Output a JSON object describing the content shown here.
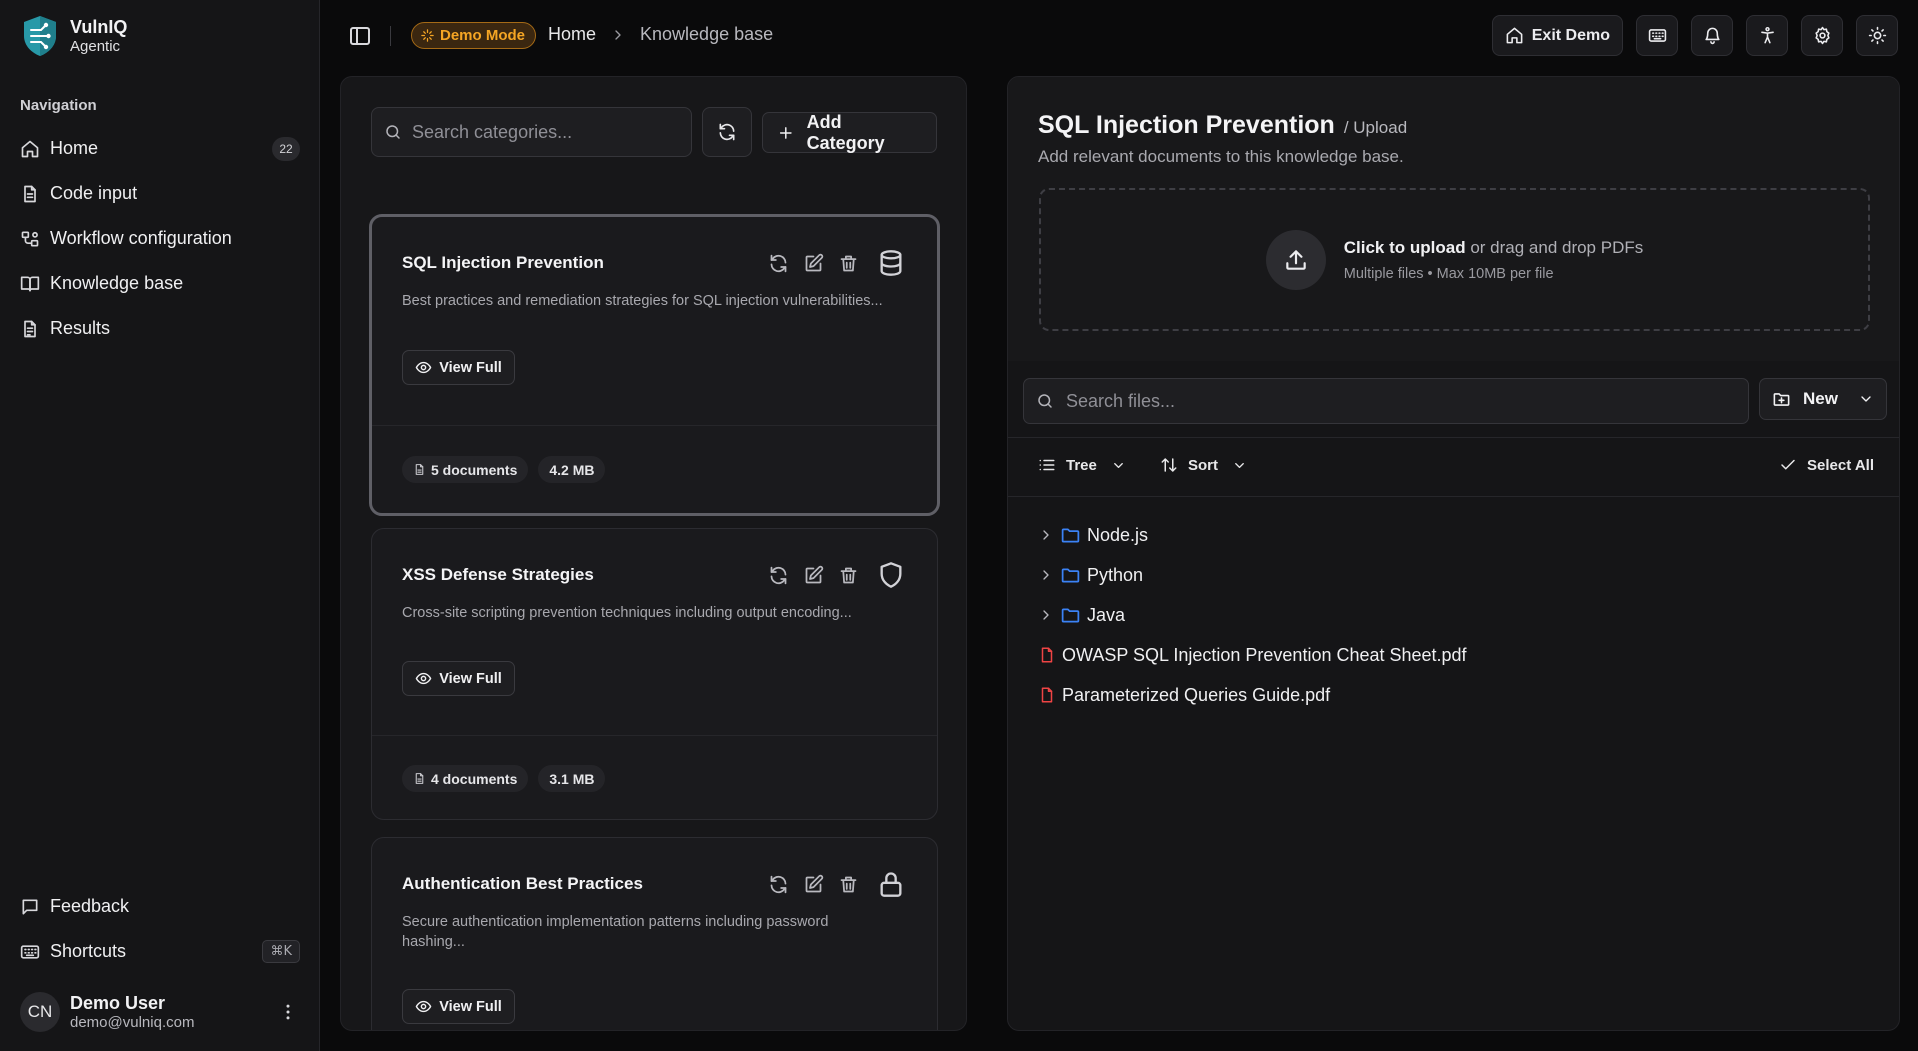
{
  "brand": {
    "name": "VulnIQ",
    "subtitle": "Agentic"
  },
  "sidebar": {
    "heading": "Navigation",
    "items": [
      {
        "label": "Home",
        "icon": "home-icon",
        "count": "22"
      },
      {
        "label": "Code input",
        "icon": "file-text-icon"
      },
      {
        "label": "Workflow configuration",
        "icon": "workflow-icon"
      },
      {
        "label": "Knowledge base",
        "icon": "book-open-icon"
      },
      {
        "label": "Results",
        "icon": "clipboard-icon"
      }
    ],
    "bottom": [
      {
        "label": "Feedback",
        "icon": "message-square-icon"
      },
      {
        "label": "Shortcuts",
        "icon": "keyboard-icon",
        "kbd": "⌘K"
      }
    ],
    "user": {
      "initials": "CN",
      "name": "Demo User",
      "email": "demo@vulniq.com"
    }
  },
  "topbar": {
    "demo_badge": "Demo Mode",
    "breadcrumbs": [
      "Home",
      "Knowledge base"
    ],
    "exit_demo": "Exit Demo"
  },
  "categories": {
    "search_placeholder": "Search categories...",
    "add_label": "Add Category",
    "view_full_label": "View Full",
    "items": [
      {
        "title": "SQL Injection Prevention",
        "description": "Best practices and remediation strategies for SQL injection vulnerabilities...",
        "documents": "5 documents",
        "size": "4.2 MB",
        "icon": "database-icon"
      },
      {
        "title": "XSS Defense Strategies",
        "description": "Cross-site scripting prevention techniques including output encoding...",
        "documents": "4 documents",
        "size": "3.1 MB",
        "icon": "shield-icon"
      },
      {
        "title": "Authentication Best Practices",
        "description": "Secure authentication implementation patterns including password hashing...",
        "icon": "lock-icon"
      }
    ]
  },
  "detail": {
    "title": "SQL Injection Prevention",
    "title_suffix": "/ Upload",
    "subtitle": "Add relevant documents to this knowledge base.",
    "upload_strong": "Click to upload",
    "upload_rest": " or drag and drop PDFs",
    "upload_hint": "Multiple files • Max 10MB per file",
    "file_search_placeholder": "Search files...",
    "new_label": "New",
    "view_mode": "Tree",
    "sort_label": "Sort",
    "select_all": "Select All",
    "tree": [
      {
        "type": "folder",
        "name": "Node.js"
      },
      {
        "type": "folder",
        "name": "Python"
      },
      {
        "type": "folder",
        "name": "Java"
      },
      {
        "type": "pdf",
        "name": "OWASP SQL Injection Prevention Cheat Sheet.pdf"
      },
      {
        "type": "pdf",
        "name": "Parameterized Queries Guide.pdf"
      }
    ]
  },
  "colors": {
    "accent": "#f5a524",
    "folder": "#3b82f6",
    "pdf": "#ef4444",
    "background": "#0a0a0b"
  }
}
